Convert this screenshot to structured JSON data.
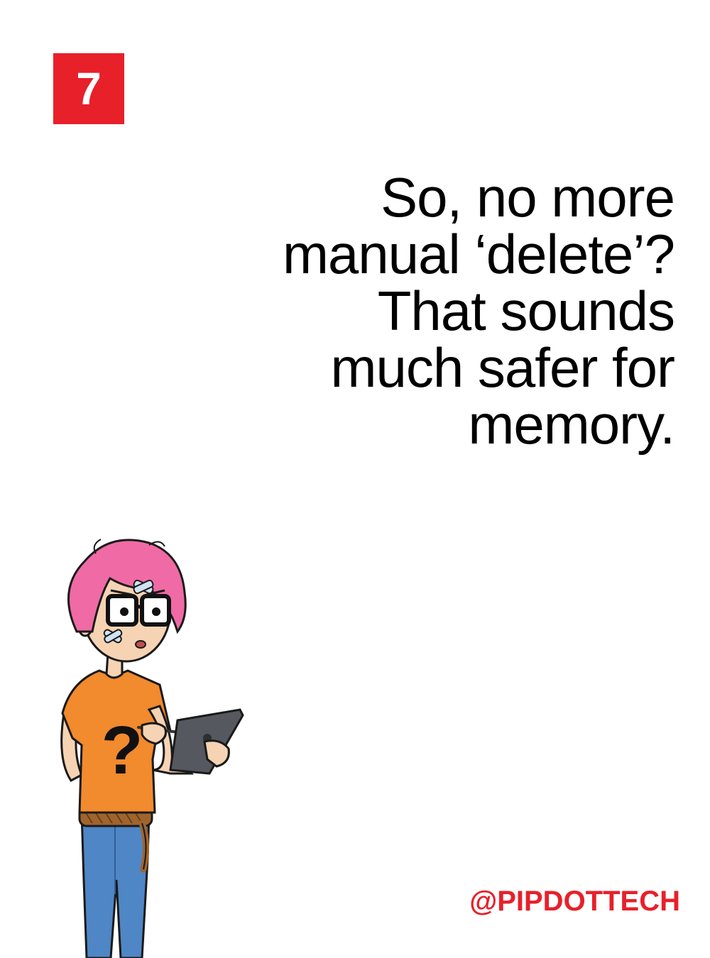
{
  "slide": {
    "number": "7",
    "lines": [
      "So, no more",
      "manual ‘delete’?",
      "That sounds",
      "much safer for",
      "memory."
    ],
    "handle": "@PIPDOTTECH"
  },
  "character": {
    "shirt_symbol": "?",
    "icon": "character-illustration"
  },
  "colors": {
    "accent": "#e8202a",
    "hair": "#f06aa5",
    "shirt": "#f28a2e",
    "jeans": "#4f86c6",
    "skin": "#f6d3b3",
    "tablet": "#55585e"
  }
}
